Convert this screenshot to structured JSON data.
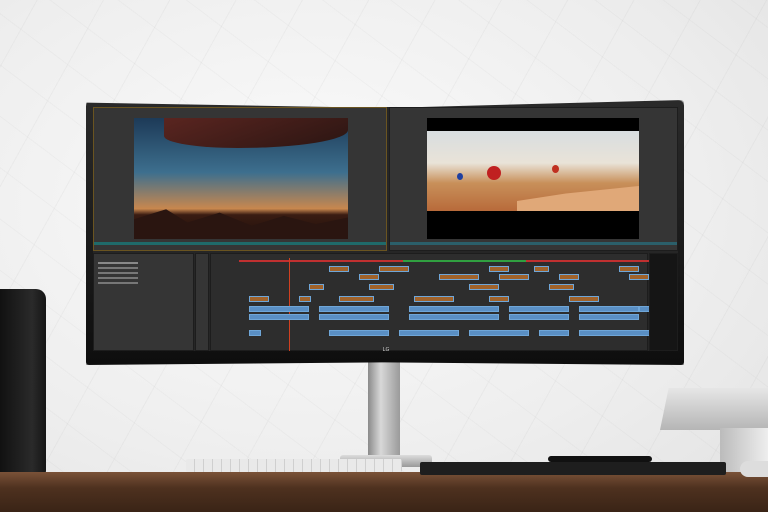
{
  "monitor": {
    "brand_logo": "LG"
  },
  "colors": {
    "timeline_clip": "#5a8fc4",
    "video_clip_thumb": "#a0622a",
    "playhead": "#d04020",
    "accent_yellow": "#e0a000"
  }
}
